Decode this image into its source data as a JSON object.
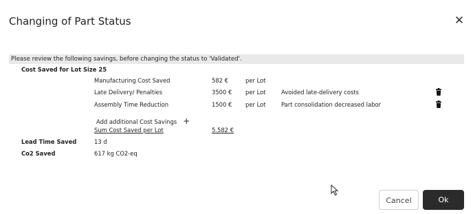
{
  "dialog": {
    "title": "Changing of Part Status",
    "close_icon": "close-icon",
    "info": "Please review the following savings, before changing the status to 'Validated'.",
    "cost_saved_header": "Cost Saved for Lot Size 25",
    "cost_rows": [
      {
        "label": "Manufacturing Cost Saved",
        "value": "582 €",
        "unit": "per Lot",
        "note": ""
      },
      {
        "label": "Late Delivery/ Penalties",
        "value": "3500 €",
        "unit": "per Lot",
        "note": "Avoided late-delivery costs",
        "delete_icon": "trash-icon"
      },
      {
        "label": "Assembly Time Reduction",
        "value": "1500 €",
        "unit": "per Lot",
        "note": "Part consolidation decreased labor",
        "delete_icon": "trash-icon"
      }
    ],
    "add_savings": {
      "label": "Add additional Cost Savings",
      "icon": "plus-icon"
    },
    "sum": {
      "label": "Sum Cost Saved per Lot",
      "value": "5.582 €"
    },
    "lead_time": {
      "label": "Lead Time Saved",
      "value": "13 d"
    },
    "co2": {
      "label": "Co2 Saved",
      "value": "617 kg CO2-eq"
    },
    "buttons": {
      "cancel": "Cancel",
      "ok": "Ok"
    },
    "cursor_icon": "mouse-pointer-icon"
  }
}
